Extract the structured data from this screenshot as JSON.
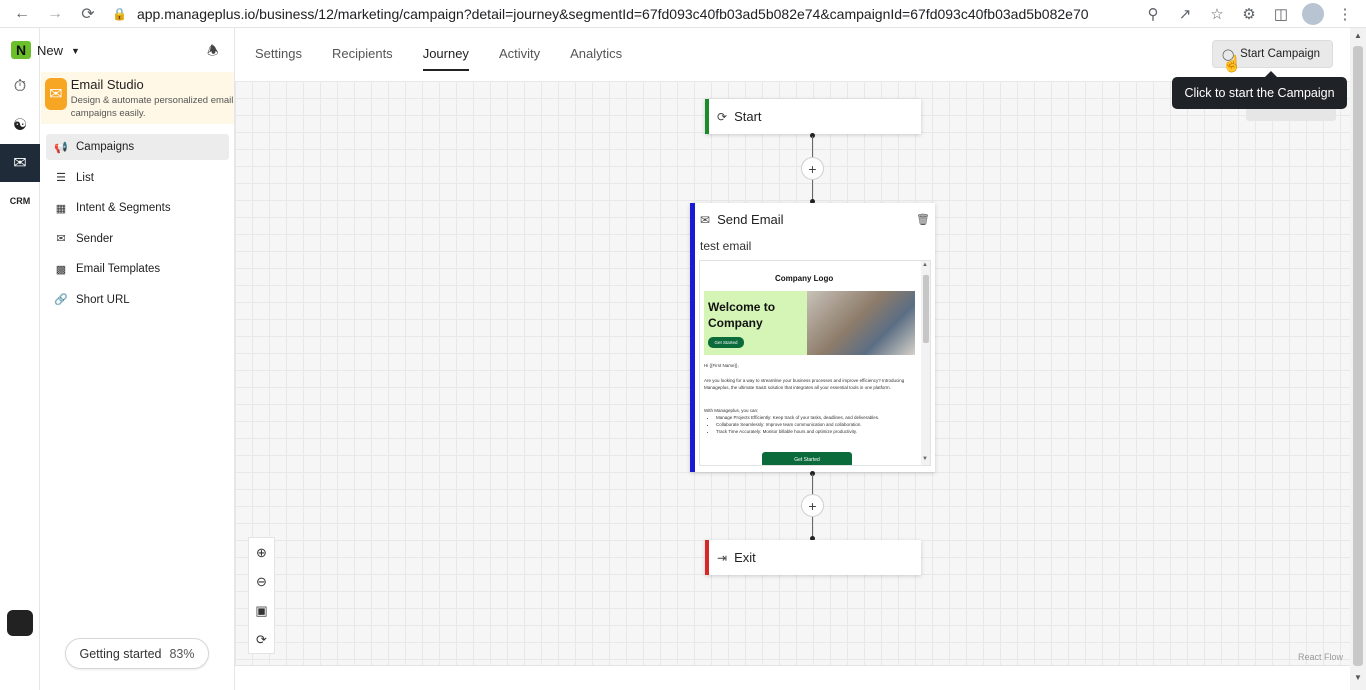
{
  "browser": {
    "url": "app.manageplus.io/business/12/marketing/campaign?detail=journey&segmentId=67fd093c40fb03ad5b082e74&campaignId=67fd093c40fb03ad5b082e70"
  },
  "workspace": {
    "logo_letter": "N",
    "name": "New"
  },
  "studio": {
    "title": "Email Studio",
    "description": "Design & automate personalized email campaigns easily."
  },
  "sidebar": {
    "items": [
      {
        "label": "Campaigns",
        "icon": "megaphone-icon",
        "active": true
      },
      {
        "label": "List",
        "icon": "list-icon",
        "active": false
      },
      {
        "label": "Intent & Segments",
        "icon": "segments-icon",
        "active": false
      },
      {
        "label": "Sender",
        "icon": "sender-icon",
        "active": false
      },
      {
        "label": "Email Templates",
        "icon": "template-icon",
        "active": false
      },
      {
        "label": "Short URL",
        "icon": "link-icon",
        "active": false
      }
    ]
  },
  "rail": {
    "crm_label": "CRM"
  },
  "getting_started": {
    "label": "Getting started",
    "percent": "83%"
  },
  "tabs": [
    {
      "label": "Settings",
      "active": false
    },
    {
      "label": "Recipients",
      "active": false
    },
    {
      "label": "Journey",
      "active": true
    },
    {
      "label": "Activity",
      "active": false
    },
    {
      "label": "Analytics",
      "active": false
    }
  ],
  "start_campaign": {
    "label": "Start Campaign",
    "tooltip": "Click to start the Campaign"
  },
  "journey": {
    "start_node": "Start",
    "email_node": {
      "title": "Send Email",
      "subject": "test email",
      "preview": {
        "logo": "Company Logo",
        "hero_title": "Welcome to Company",
        "hero_button": "Get Started",
        "greeting": "Hi {{First Name}},",
        "para1": "Are you looking for a way to streamline your business processes and improve efficiency? Introducing Manageplus, the ultimate SaaS solution that integrates all your essential tools in one platform.",
        "para2": "With Manageplus, you can:",
        "bullets": [
          "Manage Projects Efficiently: Keep track of your tasks, deadlines, and deliverables.",
          "Collaborate Seamlessly: Improve team communication and collaboration.",
          "Track Time Accurately: Monitor billable hours and optimize productivity."
        ],
        "cta": "Get Started"
      }
    },
    "exit_node": "Exit"
  },
  "react_flow_label": "React Flow"
}
